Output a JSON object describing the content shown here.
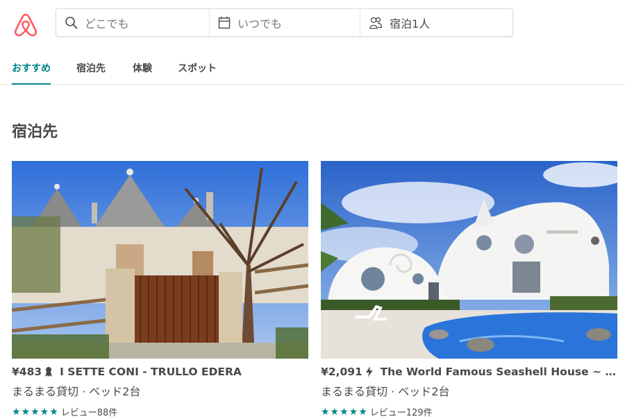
{
  "search": {
    "where_placeholder": "どこでも",
    "when_placeholder": "いつでも",
    "guests_value": "宿泊1人"
  },
  "tabs": [
    {
      "label": "おすすめ",
      "active": true
    },
    {
      "label": "宿泊先",
      "active": false
    },
    {
      "label": "体験",
      "active": false
    },
    {
      "label": "スポット",
      "active": false
    }
  ],
  "section": {
    "title": "宿泊先"
  },
  "listings": [
    {
      "price": "¥483",
      "badge_icon": "trophy-icon",
      "title": "I SETTE CONI - TRULLO EDERA",
      "details": "まるまる貸切 · ベッド2台",
      "stars": "★★★★★",
      "reviews": "レビュー88件"
    },
    {
      "price": "¥2,091",
      "badge_icon": "instant-book-icon",
      "title": "The World Famous Seashell House ~ C…",
      "details": "まるまる貸切 · ベッド2台",
      "stars": "★★★★★",
      "reviews": "レビュー129件"
    }
  ],
  "colors": {
    "brand": "#FF5A5F",
    "accent": "#008489",
    "text": "#484848"
  }
}
